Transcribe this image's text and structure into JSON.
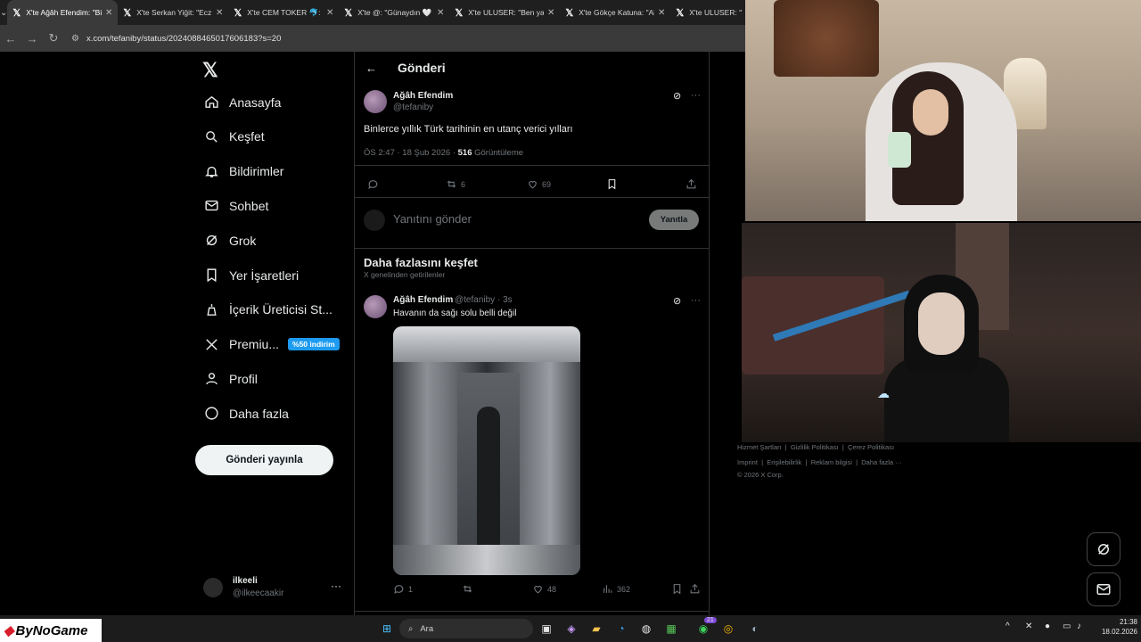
{
  "browser": {
    "tabs": [
      {
        "title": "X'te Ağâh Efendim: \"Binlerce",
        "active": true
      },
      {
        "title": "X'te Serkan Yiğit: \"Ecz",
        "active": false
      },
      {
        "title": "X'te CEM TOKER 🐬: \"",
        "active": false
      },
      {
        "title": "X'te @: \"Günaydın 🤍",
        "active": false
      },
      {
        "title": "X'te ULUSER: \"Ben ya",
        "active": false
      },
      {
        "title": "X'te Gökçe Katuna: \"Al",
        "active": false
      },
      {
        "title": "X'te ULUSER: \"",
        "active": false
      }
    ],
    "url": "x.com/tefaniby/status/2024088465017606183?s=20"
  },
  "sidebar": {
    "items": [
      {
        "label": "Anasayfa",
        "icon": "home-icon"
      },
      {
        "label": "Keşfet",
        "icon": "search-icon"
      },
      {
        "label": "Bildirimler",
        "icon": "bell-icon"
      },
      {
        "label": "Sohbet",
        "icon": "mail-icon"
      },
      {
        "label": "Grok",
        "icon": "grok-icon"
      },
      {
        "label": "Yer İşaretleri",
        "icon": "bookmark-icon"
      },
      {
        "label": "İçerik Üreticisi St...",
        "icon": "creator-icon"
      },
      {
        "label": "Premiu...",
        "icon": "x-icon",
        "badge": "%50 indirim"
      },
      {
        "label": "Profil",
        "icon": "person-icon"
      },
      {
        "label": "Daha fazla",
        "icon": "more-circle-icon"
      }
    ],
    "post_button": "Gönderi yayınla",
    "account": {
      "name": "ilkeeli",
      "handle": "@ilkeecaakir"
    }
  },
  "main": {
    "header_title": "Gönderi",
    "post": {
      "name": "Ağâh Efendim",
      "handle": "@tefaniby",
      "text": "Binlerce yıllık Türk tarihinin en utanç verici yılları",
      "time": "ÖS 2:47 · 18 Şub 2026 · ",
      "views": "516",
      "views_label": " Görüntüleme",
      "reposts": "6",
      "likes": "69"
    },
    "reply_placeholder": "Yanıtını gönder",
    "reply_button": "Yanıtla",
    "discover_title": "Daha fazlasını keşfet",
    "discover_subtitle": "X genelinden getirilenler",
    "post2": {
      "name": "Ağâh Efendim",
      "handle": "@tefaniby · 3s",
      "text": "Havanın da sağı solu belli değil",
      "replies": "1",
      "likes": "48",
      "views": "362"
    }
  },
  "footer": {
    "line1": [
      "Hizmet Şartları",
      "Gizlilik Politikası",
      "Çerez Politikası"
    ],
    "line2": [
      "Imprint",
      "Erişilebilirlik",
      "Reklam bilgisi",
      "Daha fazla ···"
    ],
    "copyright": "© 2026 X Corp."
  },
  "taskbar": {
    "brand": "ByNoGame",
    "search": "Ara",
    "time": "21:38",
    "date": "18.02.2026",
    "whatsapp_badge": "21"
  }
}
